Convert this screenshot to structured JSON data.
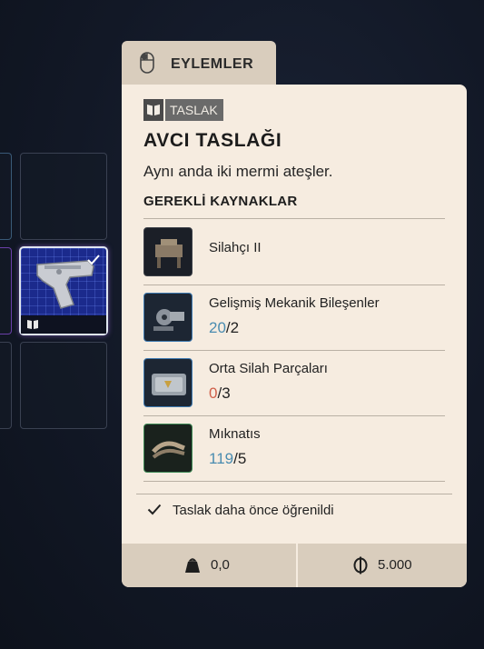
{
  "tab": {
    "label": "EYLEMLER",
    "icon": "mouse-icon"
  },
  "panel": {
    "badge": "TASLAK",
    "title": "AVCI TASLAĞI",
    "description": "Aynı anda iki mermi ateşler.",
    "section_title": "GEREKLİ KAYNAKLAR",
    "resources": [
      {
        "name": "Silahçı II",
        "have": "",
        "sep": "",
        "need": "",
        "icon": "workbench-icon"
      },
      {
        "name": "Gelişmiş Mekanik Bileşenler",
        "have": "20",
        "sep": "/",
        "need": "2",
        "icon": "mechanical-parts-icon"
      },
      {
        "name": "Orta Silah Parçaları",
        "have": "0",
        "sep": "/",
        "need": "3",
        "icon": "weapon-parts-case-icon"
      },
      {
        "name": "Mıknatıs",
        "have": "119",
        "sep": "/",
        "need": "5",
        "icon": "magnet-icon"
      }
    ],
    "learned_text": "Taslak daha önce öğrenildi",
    "weight": "0,0",
    "price": "5.000"
  },
  "colors": {
    "panel_bg": "#f6ece0",
    "tab_bg": "#d9cdbd",
    "have_ok": "#4a8cb0",
    "have_low": "#d0604a"
  }
}
